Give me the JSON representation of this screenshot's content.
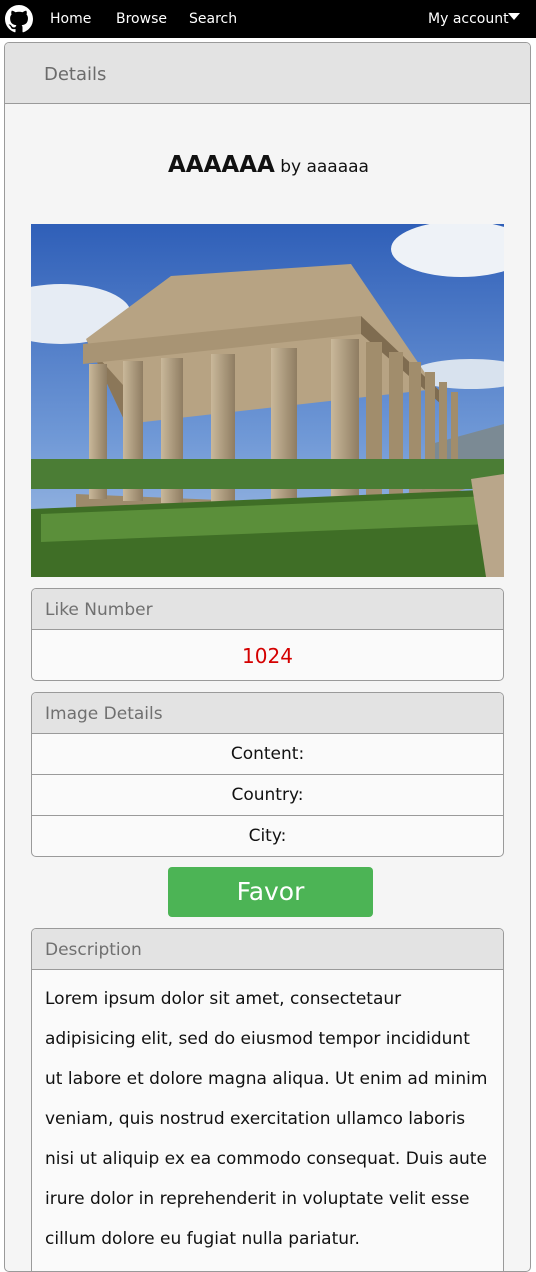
{
  "nav": {
    "home": "Home",
    "browse": "Browse",
    "search": "Search",
    "account": "My account"
  },
  "card": {
    "header": "Details"
  },
  "artwork": {
    "title": "AAAAAA",
    "byline": "by aaaaaa"
  },
  "like_panel": {
    "title": "Like Number",
    "count": "1024"
  },
  "details_panel": {
    "title": "Image Details",
    "rows": [
      "Content:",
      "Country:",
      "City:"
    ]
  },
  "favor_button": "Favor",
  "description": {
    "title": "Description",
    "text": "Lorem ipsum dolor sit amet, consectetaur adipisicing elit, sed do eiusmod tempor incididunt ut labore et dolore magna aliqua. Ut enim ad minim veniam, quis nostrud exercitation ullamco laboris nisi ut aliquip ex ea commodo consequat. Duis aute irure dolor in reprehenderit in voluptate velit esse cillum dolore eu fugiat nulla pariatur."
  },
  "colors": {
    "navbar": "#000000",
    "favor_button": "#4cb455",
    "like_count": "#d40000"
  },
  "icons": {
    "logo": "github-octocat-icon",
    "account_dropdown": "caret-down-icon"
  }
}
